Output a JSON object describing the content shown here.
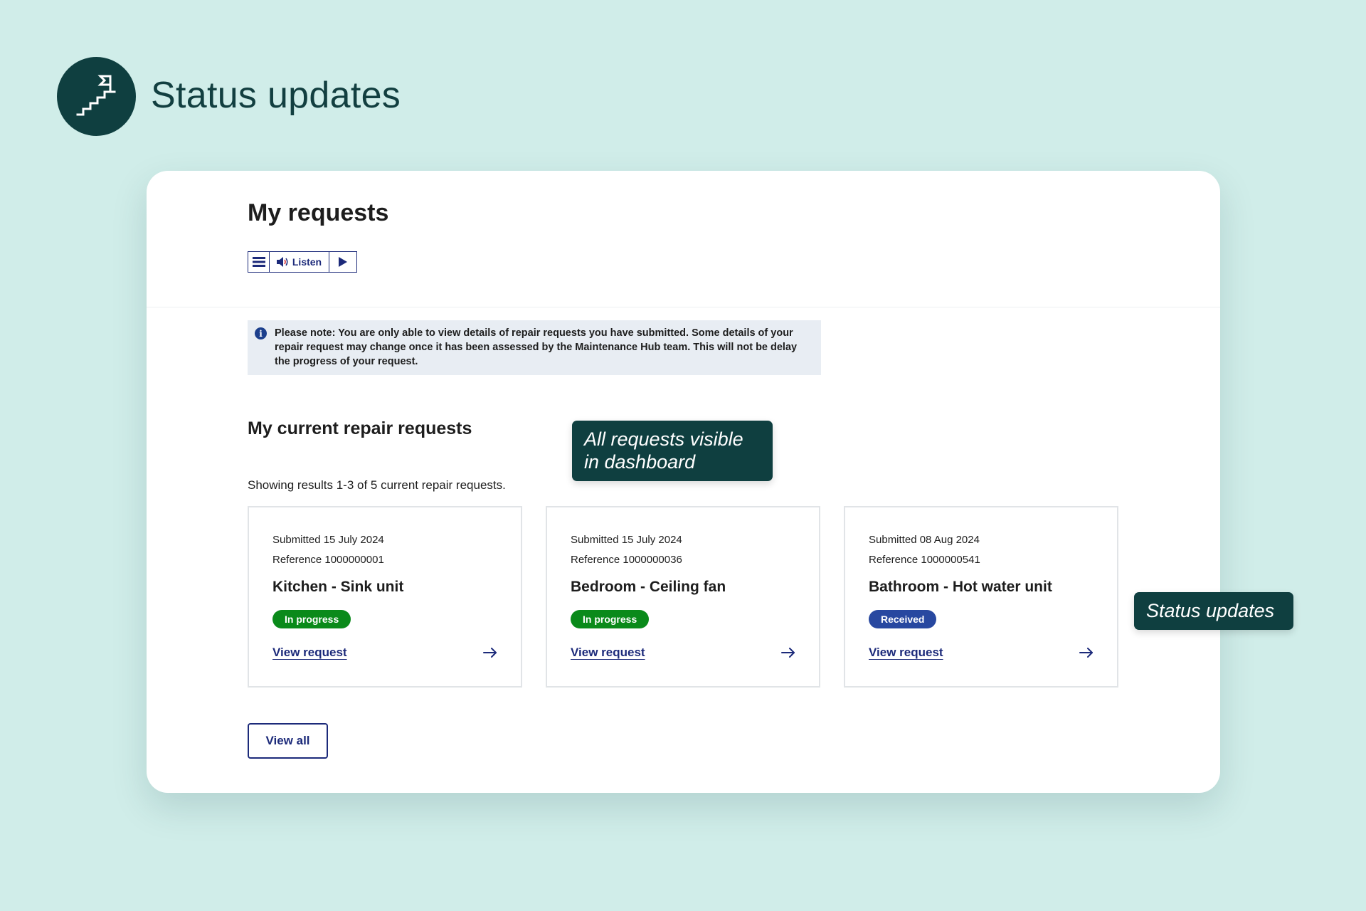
{
  "hero": {
    "title": "Status updates",
    "logo_icon": "stairs-flag-icon"
  },
  "page": {
    "title": "My requests",
    "listen": {
      "menu_icon": "menu-icon",
      "label": "Listen",
      "speaker_icon": "speaker-icon",
      "play_icon": "play-icon"
    },
    "notice": "Please note: You are only able to view details of repair requests you have submitted. Some details of your repair request may change once it has been assessed by the Maintenance Hub team. This will not be delay the progress of your request.",
    "section_title": "My current repair requests",
    "results_text": "Showing results 1-3 of 5 current repair requests.",
    "requests": [
      {
        "submitted": "Submitted 15 July 2024",
        "reference": "Reference 1000000001",
        "name": "Kitchen - Sink unit",
        "status": "In progress",
        "status_color": "#0a8a1a",
        "link": "View request"
      },
      {
        "submitted": "Submitted 15 July 2024",
        "reference": "Reference 1000000036",
        "name": "Bedroom - Ceiling fan",
        "status": "In progress",
        "status_color": "#0a8a1a",
        "link": "View request"
      },
      {
        "submitted": "Submitted 08 Aug 2024",
        "reference": "Reference 1000000541",
        "name": "Bathroom - Hot water unit",
        "status": "Received",
        "status_color": "#2848a0",
        "link": "View request"
      }
    ],
    "view_all": "View all"
  },
  "callouts": {
    "dashboard": "All requests visible in dashboard",
    "status": "Status updates"
  },
  "colors": {
    "background": "#d0ede9",
    "brand_dark": "#0f3f40",
    "link": "#1c2a7a"
  }
}
